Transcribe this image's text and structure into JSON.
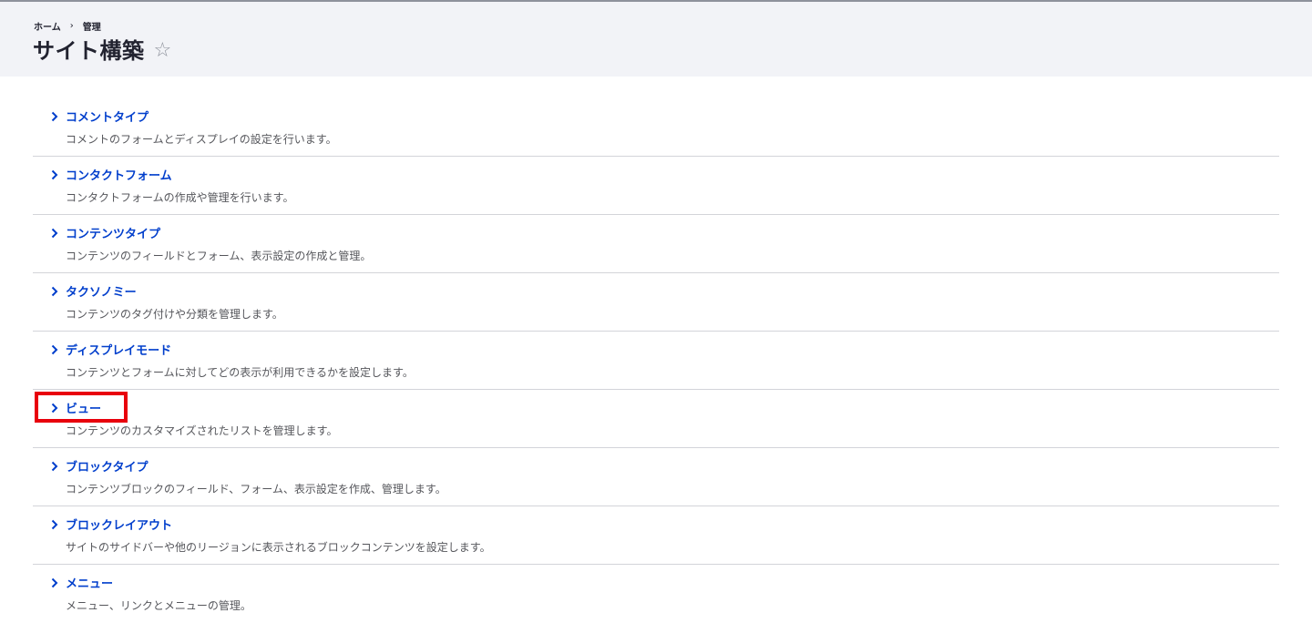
{
  "breadcrumb": {
    "home": "ホーム",
    "separator": "›",
    "admin": "管理"
  },
  "page": {
    "title": "サイト構築",
    "star": "☆"
  },
  "items": [
    {
      "label": "コメントタイプ",
      "description": "コメントのフォームとディスプレイの設定を行います。"
    },
    {
      "label": "コンタクトフォーム",
      "description": "コンタクトフォームの作成や管理を行います。"
    },
    {
      "label": "コンテンツタイプ",
      "description": "コンテンツのフィールドとフォーム、表示設定の作成と管理。"
    },
    {
      "label": "タクソノミー",
      "description": "コンテンツのタグ付けや分類を管理します。"
    },
    {
      "label": "ディスプレイモード",
      "description": "コンテンツとフォームに対してどの表示が利用できるかを設定します。"
    },
    {
      "label": "ビュー",
      "description": "コンテンツのカスタマイズされたリストを管理します。"
    },
    {
      "label": "ブロックタイプ",
      "description": "コンテンツブロックのフィールド、フォーム、表示設定を作成、管理します。"
    },
    {
      "label": "ブロックレイアウト",
      "description": "サイトのサイドバーや他のリージョンに表示されるブロックコンテンツを設定します。"
    },
    {
      "label": "メニュー",
      "description": "メニュー、リンクとメニューの管理。"
    }
  ],
  "colors": {
    "link": "#003ecc",
    "highlight": "#e8000c",
    "header_bg": "#f2f3f7"
  }
}
